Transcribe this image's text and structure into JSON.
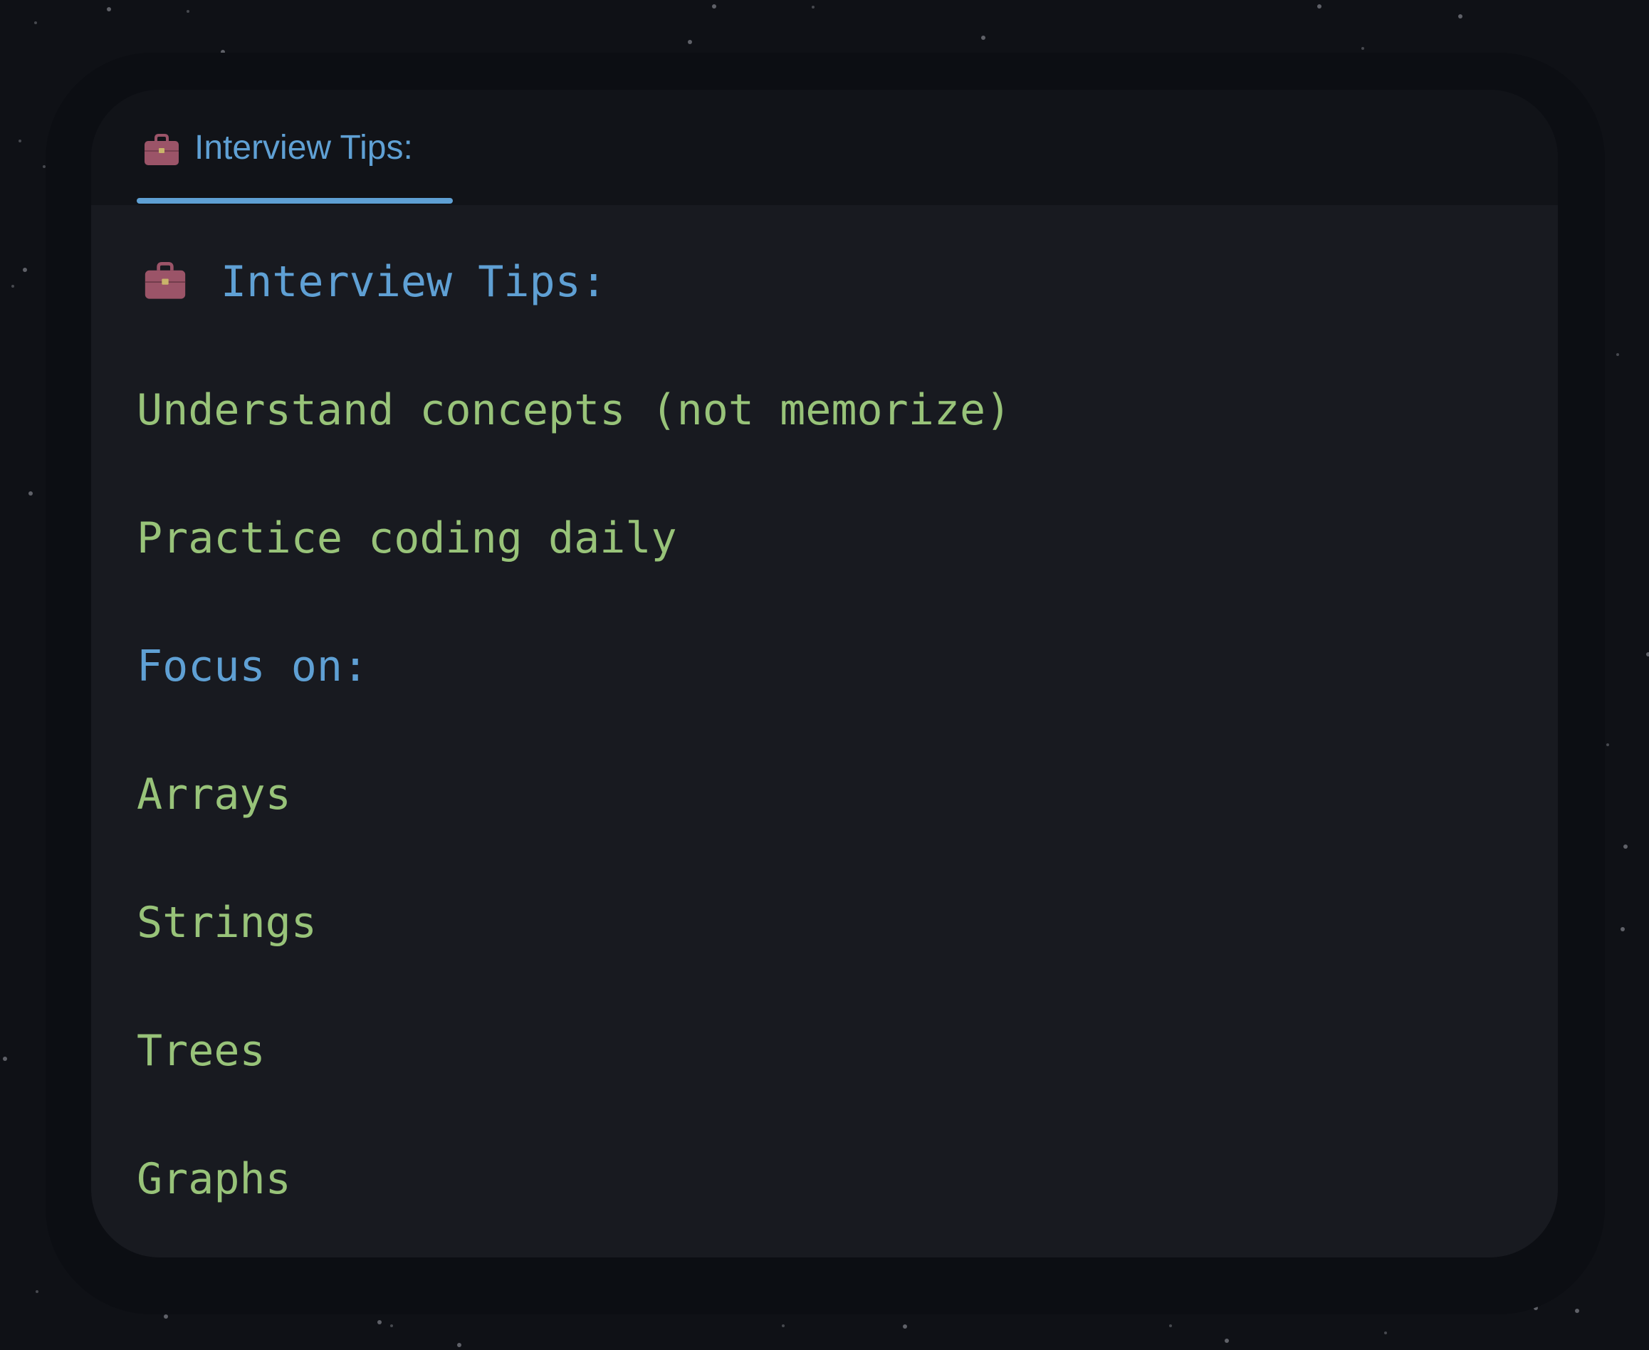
{
  "tab": {
    "icon": "briefcase-icon",
    "label": "Interview Tips:"
  },
  "content": {
    "heading_icon": "briefcase-icon",
    "heading": "Interview Tips:",
    "lines": [
      {
        "text": "Understand concepts (not memorize)",
        "color": "#98c379"
      },
      {
        "text": "Practice coding daily",
        "color": "#98c379"
      },
      {
        "text": "Focus on:",
        "color": "#5fa0d4"
      },
      {
        "text": "Arrays",
        "color": "#98c379"
      },
      {
        "text": "Strings",
        "color": "#98c379"
      },
      {
        "text": "Trees",
        "color": "#98c379"
      },
      {
        "text": "Graphs",
        "color": "#98c379"
      }
    ]
  },
  "colors": {
    "accent": "#5fa0d4",
    "text_green": "#98c379",
    "background": "#0f1116",
    "panel": "#181a20",
    "icon": "#9b5468"
  }
}
